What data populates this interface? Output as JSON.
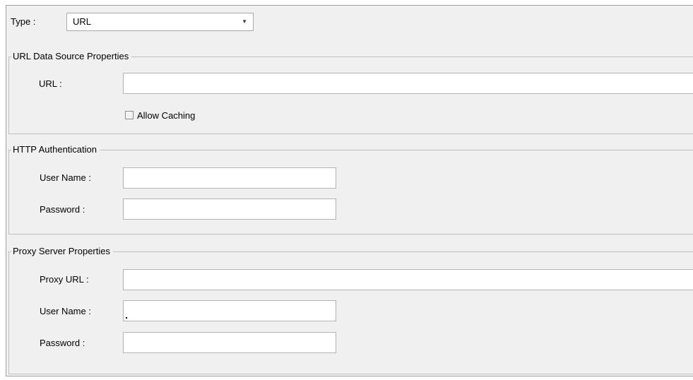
{
  "type_row": {
    "label": "Type :",
    "selected": "URL"
  },
  "url_source": {
    "legend": "URL Data Source Properties",
    "url_label": "URL :",
    "url_value": "",
    "allow_caching_label": "Allow Caching",
    "allow_caching_checked": false
  },
  "http_auth": {
    "legend": "HTTP Authentication",
    "username_label": "User Name :",
    "username_value": "",
    "password_label": "Password :",
    "password_value": ""
  },
  "proxy": {
    "legend": "Proxy Server Properties",
    "proxy_url_label": "Proxy URL :",
    "proxy_url_value": "",
    "username_label": "User Name :",
    "username_value": "",
    "password_label": "Password :",
    "password_value": ""
  },
  "icons": {
    "dropdown": "chevron-down-icon",
    "checkbox": "checkbox-icon"
  }
}
